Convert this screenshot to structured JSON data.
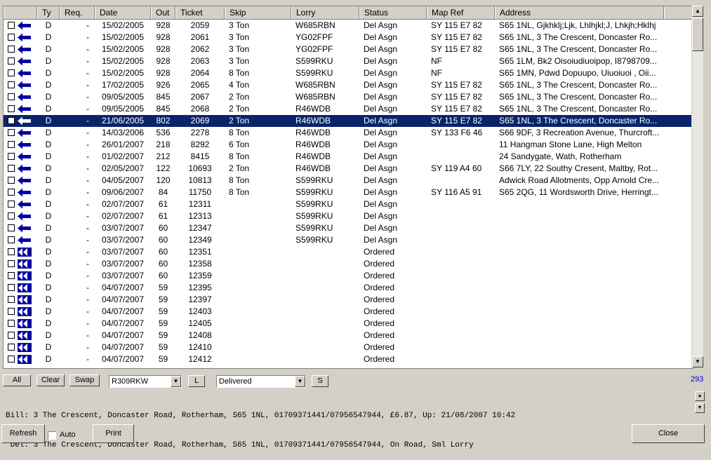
{
  "columns": [
    "",
    "Ty",
    "Req.",
    "Date",
    "Out",
    "Ticket",
    "Skip",
    "Lorry",
    "Status",
    "Map Ref",
    "Address"
  ],
  "rows": [
    {
      "ty": "D",
      "req": "-",
      "date": "15/02/2005",
      "out": "928",
      "ticket": "2059",
      "skip": "3 Ton",
      "lorry": "W685RBN",
      "status": "Del Asgn",
      "mapref": "SY 115 E7 82",
      "address": "S65 1NL, Gjkhklj;Ljk, Lhlhjkl;J, Lhkjh;Hklhj",
      "arrow": "single",
      "selected": false
    },
    {
      "ty": "D",
      "req": "-",
      "date": "15/02/2005",
      "out": "928",
      "ticket": "2061",
      "skip": "3 Ton",
      "lorry": "YG02FPF",
      "status": "Del Asgn",
      "mapref": "SY 115 E7 82",
      "address": "S65 1NL, 3 The Crescent, Doncaster Ro...",
      "arrow": "single",
      "selected": false
    },
    {
      "ty": "D",
      "req": "-",
      "date": "15/02/2005",
      "out": "928",
      "ticket": "2062",
      "skip": "3 Ton",
      "lorry": "YG02FPF",
      "status": "Del Asgn",
      "mapref": "SY 115 E7 82",
      "address": "S65 1NL, 3 The Crescent, Doncaster Ro...",
      "arrow": "single",
      "selected": false
    },
    {
      "ty": "D",
      "req": "-",
      "date": "15/02/2005",
      "out": "928",
      "ticket": "2063",
      "skip": "3 Ton",
      "lorry": "S599RKU",
      "status": "Del Asgn",
      "mapref": "NF",
      "address": "S65 1LM, Bk2 Oisoiudiuoipop, I8798709...",
      "arrow": "single",
      "selected": false
    },
    {
      "ty": "D",
      "req": "-",
      "date": "15/02/2005",
      "out": "928",
      "ticket": "2064",
      "skip": "8 Ton",
      "lorry": "S599RKU",
      "status": "Del Asgn",
      "mapref": "NF",
      "address": "S65 1MN, Pdwd Dopuupo, Uiuoiuoi , Oii...",
      "arrow": "single",
      "selected": false
    },
    {
      "ty": "D",
      "req": "-",
      "date": "17/02/2005",
      "out": "926",
      "ticket": "2065",
      "skip": "4 Ton",
      "lorry": "W685RBN",
      "status": "Del Asgn",
      "mapref": "SY 115 E7 82",
      "address": "S65 1NL, 3 The Crescent, Doncaster Ro...",
      "arrow": "single",
      "selected": false
    },
    {
      "ty": "D",
      "req": "-",
      "date": "09/05/2005",
      "out": "845",
      "ticket": "2067",
      "skip": "2 Ton",
      "lorry": "W685RBN",
      "status": "Del Asgn",
      "mapref": "SY 115 E7 82",
      "address": "S65 1NL, 3 The Crescent, Doncaster Ro...",
      "arrow": "single",
      "selected": false
    },
    {
      "ty": "D",
      "req": "-",
      "date": "09/05/2005",
      "out": "845",
      "ticket": "2068",
      "skip": "2 Ton",
      "lorry": "R46WDB",
      "status": "Del Asgn",
      "mapref": "SY 115 E7 82",
      "address": "S65 1NL, 3 The Crescent, Doncaster Ro...",
      "arrow": "single",
      "selected": false
    },
    {
      "ty": "D",
      "req": "-",
      "date": "21/06/2005",
      "out": "802",
      "ticket": "2069",
      "skip": "2 Ton",
      "lorry": "R46WDB",
      "status": "Del Asgn",
      "mapref": "SY 115 E7 82",
      "address": "S65 1NL, 3 The Crescent, Doncaster Ro...",
      "arrow": "single",
      "selected": true
    },
    {
      "ty": "D",
      "req": "-",
      "date": "14/03/2006",
      "out": "536",
      "ticket": "2278",
      "skip": "8 Ton",
      "lorry": "R46WDB",
      "status": "Del Asgn",
      "mapref": "SY 133 F6 46",
      "address": "S66 9DF, 3 Recreation Avenue, Thurcroft...",
      "arrow": "single",
      "selected": false
    },
    {
      "ty": "D",
      "req": "-",
      "date": "26/01/2007",
      "out": "218",
      "ticket": "8292",
      "skip": "6 Ton",
      "lorry": "R46WDB",
      "status": "Del Asgn",
      "mapref": "",
      "address": "11 Hangman Stone Lane, High Melton",
      "arrow": "single",
      "selected": false
    },
    {
      "ty": "D",
      "req": "-",
      "date": "01/02/2007",
      "out": "212",
      "ticket": "8415",
      "skip": "8 Ton",
      "lorry": "R46WDB",
      "status": "Del Asgn",
      "mapref": "",
      "address": "24 Sandygate, Wath, Rotherham",
      "arrow": "single",
      "selected": false
    },
    {
      "ty": "D",
      "req": "-",
      "date": "02/05/2007",
      "out": "122",
      "ticket": "10693",
      "skip": "2 Ton",
      "lorry": "R46WDB",
      "status": "Del Asgn",
      "mapref": "SY 119 A4 60",
      "address": "S66 7LY, 22 Southy Cresent, Maltby, Rot...",
      "arrow": "single",
      "selected": false
    },
    {
      "ty": "D",
      "req": "-",
      "date": "04/05/2007",
      "out": "120",
      "ticket": "10813",
      "skip": "8 Ton",
      "lorry": "S599RKU",
      "status": "Del Asgn",
      "mapref": "",
      "address": "Adwick Road Allotments, Opp Arnold Cre...",
      "arrow": "single",
      "selected": false
    },
    {
      "ty": "D",
      "req": "-",
      "date": "09/06/2007",
      "out": "84",
      "ticket": "11750",
      "skip": "8 Ton",
      "lorry": "S599RKU",
      "status": "Del Asgn",
      "mapref": "SY 116 A5 91",
      "address": "S65 2QG, 11 Wordsworth Drive, Herringt...",
      "arrow": "single",
      "selected": false
    },
    {
      "ty": "D",
      "req": "-",
      "date": "02/07/2007",
      "out": "61",
      "ticket": "12311",
      "skip": "",
      "lorry": "S599RKU",
      "status": "Del Asgn",
      "mapref": "",
      "address": "",
      "arrow": "single",
      "selected": false
    },
    {
      "ty": "D",
      "req": "-",
      "date": "02/07/2007",
      "out": "61",
      "ticket": "12313",
      "skip": "",
      "lorry": "S599RKU",
      "status": "Del Asgn",
      "mapref": "",
      "address": "",
      "arrow": "single",
      "selected": false
    },
    {
      "ty": "D",
      "req": "-",
      "date": "03/07/2007",
      "out": "60",
      "ticket": "12347",
      "skip": "",
      "lorry": "S599RKU",
      "status": "Del Asgn",
      "mapref": "",
      "address": "",
      "arrow": "single",
      "selected": false
    },
    {
      "ty": "D",
      "req": "-",
      "date": "03/07/2007",
      "out": "60",
      "ticket": "12349",
      "skip": "",
      "lorry": "S599RKU",
      "status": "Del Asgn",
      "mapref": "",
      "address": "",
      "arrow": "single",
      "selected": false
    },
    {
      "ty": "D",
      "req": "-",
      "date": "03/07/2007",
      "out": "60",
      "ticket": "12351",
      "skip": "",
      "lorry": "",
      "status": "Ordered",
      "mapref": "",
      "address": "",
      "arrow": "double",
      "selected": false
    },
    {
      "ty": "D",
      "req": "-",
      "date": "03/07/2007",
      "out": "60",
      "ticket": "12358",
      "skip": "",
      "lorry": "",
      "status": "Ordered",
      "mapref": "",
      "address": "",
      "arrow": "double",
      "selected": false
    },
    {
      "ty": "D",
      "req": "-",
      "date": "03/07/2007",
      "out": "60",
      "ticket": "12359",
      "skip": "",
      "lorry": "",
      "status": "Ordered",
      "mapref": "",
      "address": "",
      "arrow": "double",
      "selected": false
    },
    {
      "ty": "D",
      "req": "-",
      "date": "04/07/2007",
      "out": "59",
      "ticket": "12395",
      "skip": "",
      "lorry": "",
      "status": "Ordered",
      "mapref": "",
      "address": "",
      "arrow": "double",
      "selected": false
    },
    {
      "ty": "D",
      "req": "-",
      "date": "04/07/2007",
      "out": "59",
      "ticket": "12397",
      "skip": "",
      "lorry": "",
      "status": "Ordered",
      "mapref": "",
      "address": "",
      "arrow": "double",
      "selected": false
    },
    {
      "ty": "D",
      "req": "-",
      "date": "04/07/2007",
      "out": "59",
      "ticket": "12403",
      "skip": "",
      "lorry": "",
      "status": "Ordered",
      "mapref": "",
      "address": "",
      "arrow": "double",
      "selected": false
    },
    {
      "ty": "D",
      "req": "-",
      "date": "04/07/2007",
      "out": "59",
      "ticket": "12405",
      "skip": "",
      "lorry": "",
      "status": "Ordered",
      "mapref": "",
      "address": "",
      "arrow": "double",
      "selected": false
    },
    {
      "ty": "D",
      "req": "-",
      "date": "04/07/2007",
      "out": "59",
      "ticket": "12408",
      "skip": "",
      "lorry": "",
      "status": "Ordered",
      "mapref": "",
      "address": "",
      "arrow": "double",
      "selected": false
    },
    {
      "ty": "D",
      "req": "-",
      "date": "04/07/2007",
      "out": "59",
      "ticket": "12410",
      "skip": "",
      "lorry": "",
      "status": "Ordered",
      "mapref": "",
      "address": "",
      "arrow": "double",
      "selected": false
    },
    {
      "ty": "D",
      "req": "-",
      "date": "04/07/2007",
      "out": "59",
      "ticket": "12412",
      "skip": "",
      "lorry": "",
      "status": "Ordered",
      "mapref": "",
      "address": "",
      "arrow": "double",
      "selected": false
    }
  ],
  "toolbar": {
    "all_label": "All",
    "clear_label": "Clear",
    "swap_label": "Swap",
    "lorry_value": "R309RKW",
    "l_label": "L",
    "status_value": "Delivered",
    "s_label": "S",
    "count": "293"
  },
  "info": {
    "bill": "Bill: 3 The Crescent, Doncaster Road, Rotherham, S65 1NL, 01709371441/07956547944, £6.87, Up: 21/08/2007 10:42",
    "del": " Del: 3 The Crescent, Doncaster Road, Rotherham, S65 1NL, 01709371441/07956547944, On Road, Sml Lorry"
  },
  "footer": {
    "refresh_label": "Refresh",
    "auto_label": "Auto",
    "print_label": "Print",
    "close_label": "Close"
  },
  "colors": {
    "selection": "#0a246a",
    "arrow": "#0000a0",
    "count": "#0000cc"
  }
}
